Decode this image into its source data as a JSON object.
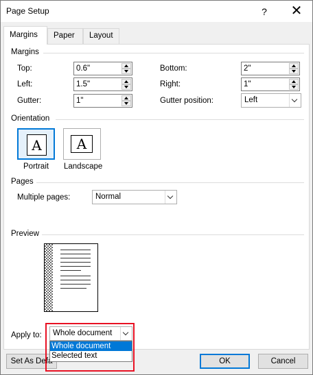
{
  "window": {
    "title": "Page Setup",
    "help": "?",
    "close": "✕"
  },
  "tabs": [
    {
      "label": "Margins"
    },
    {
      "label": "Paper"
    },
    {
      "label": "Layout"
    }
  ],
  "margins": {
    "section": "Margins",
    "top": {
      "label": "Top:",
      "value": "0.6\""
    },
    "left": {
      "label": "Left:",
      "value": "1.5\""
    },
    "gutter": {
      "label": "Gutter:",
      "value": "1\""
    },
    "bottom": {
      "label": "Bottom:",
      "value": "2\""
    },
    "right": {
      "label": "Right:",
      "value": "1\""
    },
    "gutter_position": {
      "label": "Gutter position:",
      "value": "Left"
    }
  },
  "orientation": {
    "section": "Orientation",
    "portrait": {
      "label": "Portrait",
      "glyph": "A"
    },
    "landscape": {
      "label": "Landscape",
      "glyph": "A"
    }
  },
  "pages": {
    "section": "Pages",
    "multiple_label": "Multiple pages:",
    "multiple_value": "Normal"
  },
  "preview": {
    "section": "Preview"
  },
  "apply": {
    "label": "Apply to:",
    "value": "Whole document",
    "options": [
      "Whole document",
      "Selected text"
    ]
  },
  "buttons": {
    "set_default": "Set As Defa",
    "ok": "OK",
    "cancel": "Cancel"
  },
  "colors": {
    "accent": "#0078d7",
    "highlight": "#e81123"
  }
}
